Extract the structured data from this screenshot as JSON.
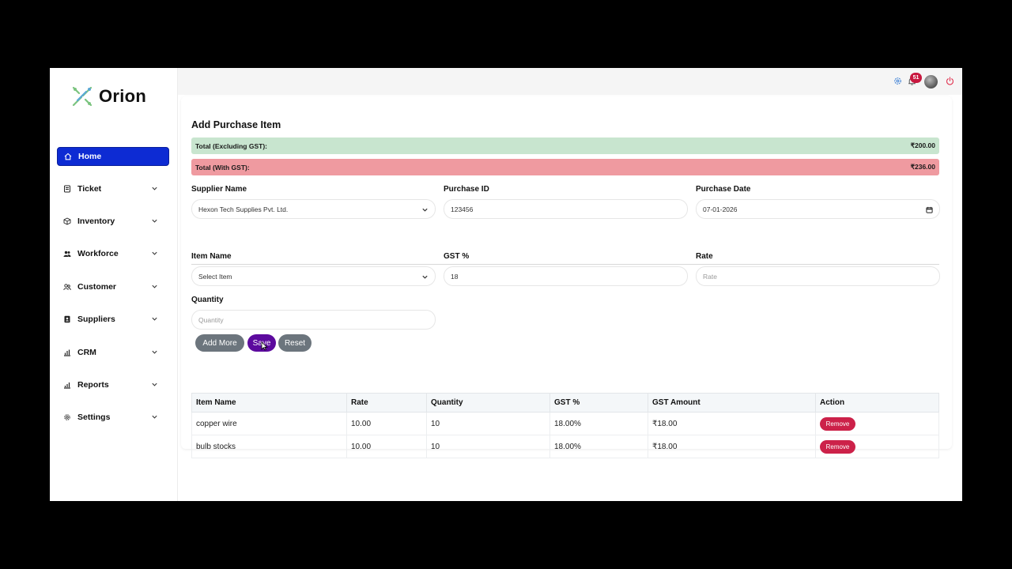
{
  "brand": {
    "name": "Orion",
    "accent": "#0d2bd3"
  },
  "sidebar": {
    "items": [
      {
        "label": "Home",
        "icon": "home-icon"
      },
      {
        "label": "Ticket",
        "icon": "ticket-icon"
      },
      {
        "label": "Inventory",
        "icon": "box-icon"
      },
      {
        "label": "Workforce",
        "icon": "users-icon"
      },
      {
        "label": "Customer",
        "icon": "customer-icon"
      },
      {
        "label": "Suppliers",
        "icon": "suppliers-icon"
      },
      {
        "label": "CRM",
        "icon": "bar-chart-icon"
      },
      {
        "label": "Reports",
        "icon": "reports-icon"
      },
      {
        "label": "Settings",
        "icon": "gear-icon"
      }
    ]
  },
  "header": {
    "notification_count": "51"
  },
  "page": {
    "title": "Add Purchase Item",
    "total_excl_label": "Total (Excluding GST):",
    "total_excl_value": "₹200.00",
    "total_incl_label": "Total (With GST):",
    "total_incl_value": "₹236.00"
  },
  "form": {
    "supplier_label": "Supplier Name",
    "supplier_value": "Hexon Tech Supplies Pvt. Ltd.",
    "purchase_id_label": "Purchase ID",
    "purchase_id_value": "123456",
    "purchase_date_label": "Purchase Date",
    "purchase_date_value": "07-01-2026",
    "item_name_label": "Item Name",
    "item_name_value": "Select Item",
    "gst_label": "GST %",
    "gst_value": "18",
    "rate_label": "Rate",
    "rate_placeholder": "Rate",
    "quantity_label": "Quantity",
    "quantity_placeholder": "Quantity"
  },
  "buttons": {
    "add_more": "Add More",
    "save": "Save",
    "reset": "Reset"
  },
  "table": {
    "headers": [
      "Item Name",
      "Rate",
      "Quantity",
      "GST %",
      "GST Amount",
      "Action"
    ],
    "rows": [
      {
        "item": "copper wire",
        "rate": "10.00",
        "quantity": "10",
        "gst": "18.00%",
        "gst_amount": "₹18.00",
        "action": "Remove"
      },
      {
        "item": "bulb stocks",
        "rate": "10.00",
        "quantity": "10",
        "gst": "18.00%",
        "gst_amount": "₹18.00",
        "action": "Remove"
      }
    ]
  },
  "colors": {
    "total_excl_bg": "#c8e5cf",
    "total_incl_bg": "#ef9aa0",
    "button_grey": "#6c757d",
    "button_save": "#5c0a9e",
    "remove_red": "#cc2149"
  }
}
